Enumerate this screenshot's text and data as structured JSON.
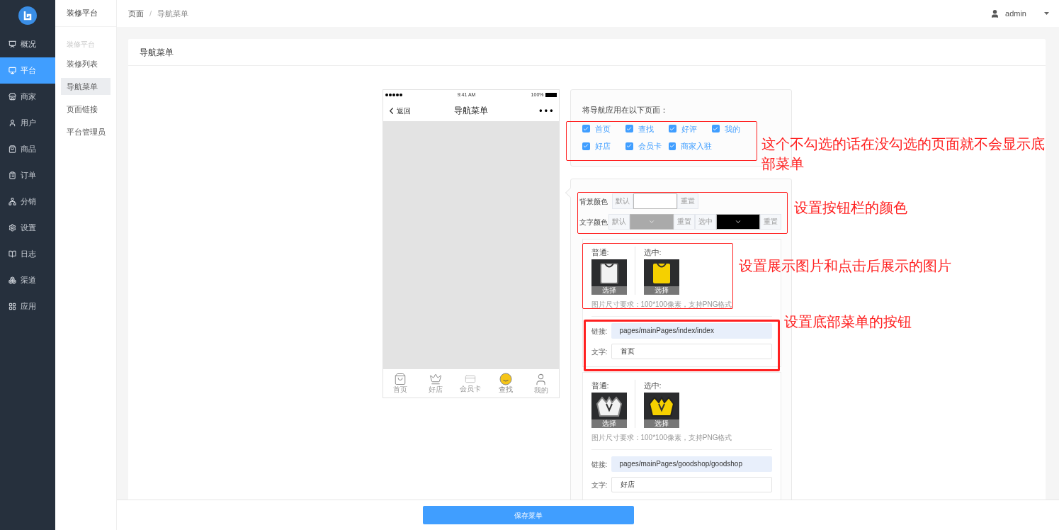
{
  "sidebar": {
    "items": [
      {
        "label": "概况",
        "selected": false
      },
      {
        "label": "平台",
        "selected": true
      },
      {
        "label": "商家",
        "selected": false
      },
      {
        "label": "用户",
        "selected": false
      },
      {
        "label": "商品",
        "selected": false
      },
      {
        "label": "订单",
        "selected": false
      },
      {
        "label": "分销",
        "selected": false
      },
      {
        "label": "设置",
        "selected": false
      },
      {
        "label": "日志",
        "selected": false
      },
      {
        "label": "渠道",
        "selected": false
      },
      {
        "label": "应用",
        "selected": false
      }
    ]
  },
  "subnav": {
    "title": "装修平台",
    "group": "装修平台",
    "items": [
      {
        "label": "装修列表",
        "selected": false
      },
      {
        "label": "导航菜单",
        "selected": true
      },
      {
        "label": "页面链接",
        "selected": false
      },
      {
        "label": "平台管理员",
        "selected": false
      }
    ]
  },
  "breadcrumb": {
    "items": [
      "页面",
      "导航菜单"
    ],
    "separator": "/"
  },
  "user": {
    "name": "admin"
  },
  "card": {
    "title": "导航菜单"
  },
  "phone": {
    "time": "9:41 AM",
    "battery": "100%",
    "back": "返回",
    "title": "导航菜单",
    "more": "• • •",
    "tabs": [
      {
        "label": "首页",
        "selected": false
      },
      {
        "label": "好店",
        "selected": false
      },
      {
        "label": "会员卡",
        "selected": false
      },
      {
        "label": "查找",
        "selected": true
      },
      {
        "label": "我的",
        "selected": false
      }
    ]
  },
  "apply_pages": {
    "label": "将导航应用在以下页面：",
    "pages": [
      {
        "label": "首页",
        "checked": true
      },
      {
        "label": "查找",
        "checked": true
      },
      {
        "label": "好评",
        "checked": true
      },
      {
        "label": "我的",
        "checked": true
      },
      {
        "label": "好店",
        "checked": true
      },
      {
        "label": "会员卡",
        "checked": true
      },
      {
        "label": "商家入驻",
        "checked": true
      }
    ]
  },
  "colors": {
    "rows": [
      {
        "label": "背景颜色",
        "default": "默认",
        "reset": "重置"
      },
      {
        "label": "文字颜色",
        "default": "默认",
        "reset": "重置",
        "selected_label": "选中",
        "selected_reset": "重置"
      }
    ]
  },
  "menu_items": [
    {
      "normal_label": "普通:",
      "active_label": "选中:",
      "normal_choose": "选择",
      "active_choose": "选择",
      "note": "图片尺寸要求：100*100像素，支持PNG格式",
      "link_label": "链接:",
      "link": "pages/mainPages/index/index",
      "text_label": "文字:",
      "text": "首页"
    },
    {
      "normal_label": "普通:",
      "active_label": "选中:",
      "normal_choose": "选择",
      "active_choose": "选择",
      "note": "图片尺寸要求：100*100像素，支持PNG格式",
      "link_label": "链接:",
      "link": "pages/mainPages/goodshop/goodshop",
      "text_label": "文字:",
      "text": "好店"
    }
  ],
  "annotations": [
    {
      "text": "这个不勾选的话在没勾选的页面就不会显示底部菜单"
    },
    {
      "text": "设置按钮栏的颜色"
    },
    {
      "text": "设置展示图片和点击后展示的图片"
    },
    {
      "text": "设置底部菜单的按钮"
    }
  ],
  "save_button": "保存菜单"
}
